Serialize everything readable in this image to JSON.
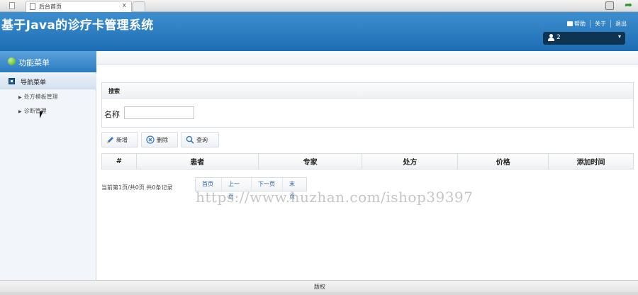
{
  "browser": {
    "tab_title": "后台首页",
    "tab_close": "x"
  },
  "header": {
    "title": "基于Java的诊疗卡管理系统",
    "links": {
      "help": "帮助",
      "about": "关于",
      "logout": "退出"
    },
    "user": {
      "name": "2",
      "caret": "▾"
    }
  },
  "sidebar": {
    "title": "功能菜单",
    "group_label": "导航菜单",
    "items": [
      {
        "label": "处方模板管理"
      },
      {
        "label": "诊断管理"
      }
    ]
  },
  "search": {
    "title": "搜索",
    "name_label": "名称",
    "name_value": ""
  },
  "toolbar": {
    "add_label": "新增",
    "delete_label": "删除",
    "query_label": "查询"
  },
  "table": {
    "columns": [
      "#",
      "患者",
      "专家",
      "处方",
      "价格",
      "添加时间"
    ],
    "rows": []
  },
  "pager": {
    "info": "当前第1页/共0页  共0条记录",
    "first": "首页",
    "prev": "上一页",
    "next": "下一页",
    "last": "末页"
  },
  "watermark": "https://www.huzhan.com/ishop39397",
  "footer": {
    "label": "版权"
  },
  "colors": {
    "header_blue": "#1d6db4",
    "sidebar_head_blue": "#2c7bc0",
    "user_box": "#0e3452",
    "link_blue": "#2a63a8"
  },
  "icons": {
    "add": "pencil-icon",
    "delete": "circle-x-icon",
    "query": "magnifier-icon",
    "menu": "green-gem-icon",
    "group": "square-icon",
    "user": "user-icon",
    "help": "help-icon"
  }
}
